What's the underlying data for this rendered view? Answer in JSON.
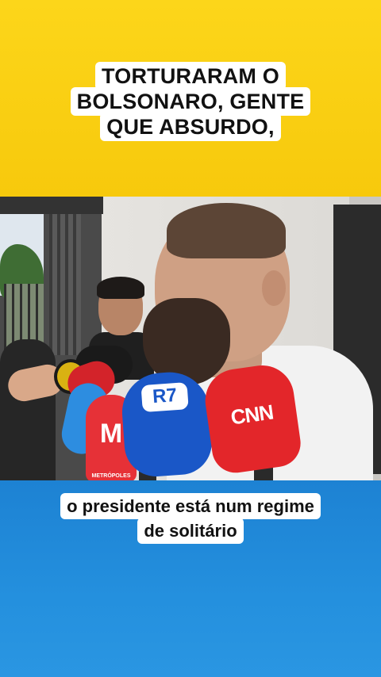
{
  "caption_top": {
    "lines": [
      "TORTURARAM O",
      "BOLSONARO, GENTE",
      "QUE ABSURDO,"
    ]
  },
  "caption_bottom": {
    "lines": [
      "o presidente está num regime",
      "de solitário"
    ]
  },
  "photo": {
    "mic_labels": {
      "cnn": "CNN",
      "r7": "R7",
      "metropoles": "M",
      "metropoles_sub": "METRÓPOLES"
    }
  },
  "colors": {
    "top_band": "#f7c90c",
    "bottom_band": "#1f86d6",
    "caption_bg": "#ffffff"
  }
}
